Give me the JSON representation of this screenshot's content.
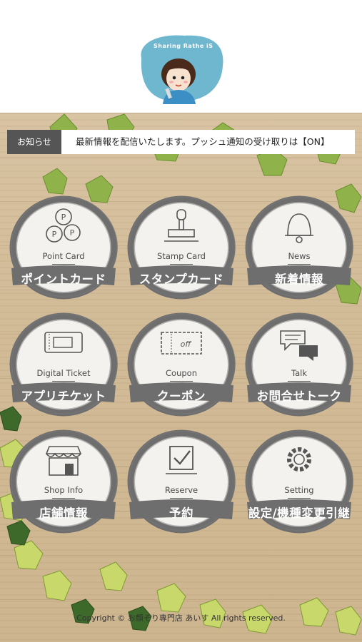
{
  "header": {
    "logo_text": "Sharing Rathe iS"
  },
  "notice": {
    "label": "お知らせ",
    "text": "最新情報を配信いたします。プッシュ通知の受け取りは【ON】"
  },
  "menu": [
    {
      "en": "Point Card",
      "jp": "ポイントカード",
      "icon": "coins-icon"
    },
    {
      "en": "Stamp Card",
      "jp": "スタンプカード",
      "icon": "stamp-icon"
    },
    {
      "en": "News",
      "jp": "新着情報",
      "icon": "bell-icon"
    },
    {
      "en": "Digital Ticket",
      "jp": "アプリチケット",
      "icon": "ticket-icon"
    },
    {
      "en": "Coupon",
      "jp": "クーポン",
      "icon": "coupon-icon"
    },
    {
      "en": "Talk",
      "jp": "お問合せトーク",
      "icon": "chat-bubbles-icon"
    },
    {
      "en": "Shop Info",
      "jp": "店舗情報",
      "icon": "shop-icon"
    },
    {
      "en": "Reserve",
      "jp": "予約",
      "icon": "checkbox-icon"
    },
    {
      "en": "Setting",
      "jp": "設定/機種変更引継",
      "icon": "gear-icon"
    }
  ],
  "footer": {
    "copyright": "Copyright © お顔そり専門店 あいす All rights reserved."
  }
}
